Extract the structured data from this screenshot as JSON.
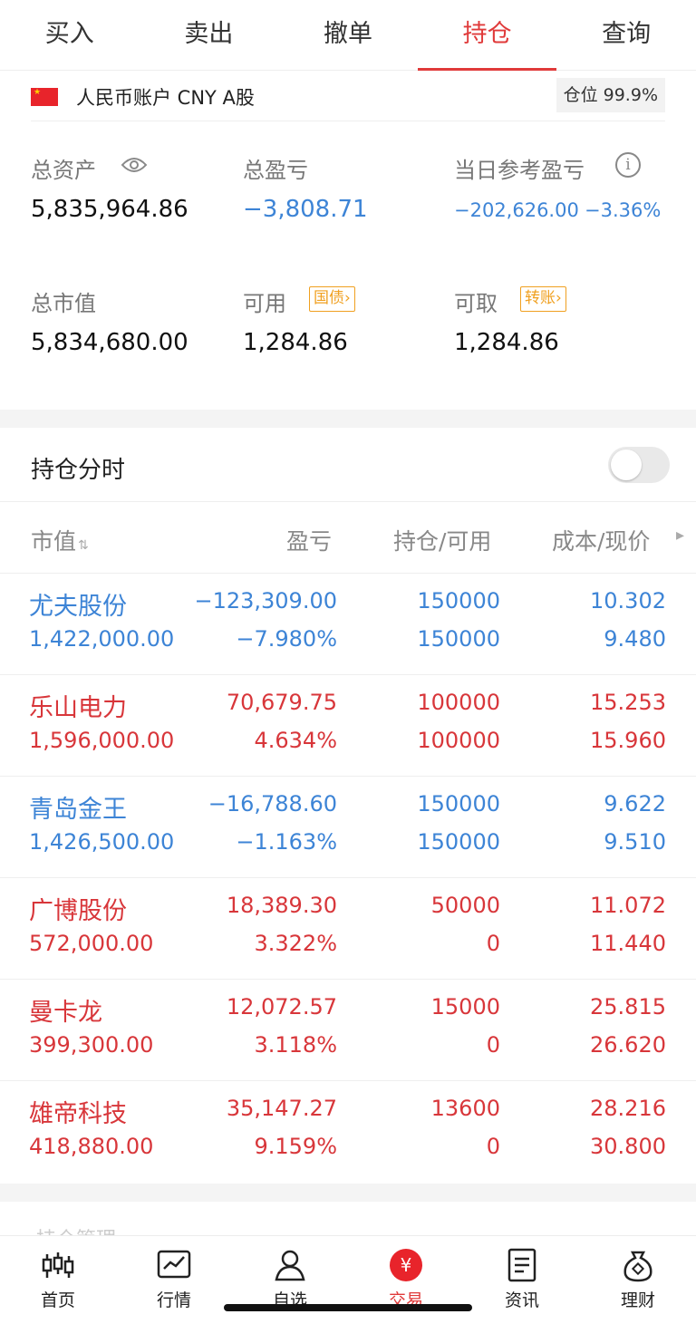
{
  "tabs": [
    "买入",
    "卖出",
    "撤单",
    "持仓",
    "查询"
  ],
  "account": {
    "name": "人民币账户 CNY A股",
    "position_ratio": "仓位 99.9%"
  },
  "summary": {
    "total_assets_label": "总资产",
    "total_assets": "5,835,964.86",
    "total_pl_label": "总盈亏",
    "total_pl": "−3,808.71",
    "daily_pl_label": "当日参考盈亏",
    "daily_pl": "−202,626.00",
    "daily_pl_pct": "−3.36%",
    "market_value_label": "总市值",
    "market_value": "5,834,680.00",
    "available_label": "可用",
    "available": "1,284.86",
    "bond_chip": "国债",
    "withdrawable_label": "可取",
    "withdrawable": "1,284.86",
    "transfer_chip": "转账"
  },
  "realtime_label": "持仓分时",
  "columns": [
    "市值",
    "盈亏",
    "持仓/可用",
    "成本/现价"
  ],
  "holdings": [
    {
      "name": "尤夫股份",
      "mv": "1,422,000.00",
      "pl": "−123,309.00",
      "pl_pct": "−7.980%",
      "qty": "150000",
      "avail": "150000",
      "cost": "10.302",
      "price": "9.480",
      "color": "#3d84d6"
    },
    {
      "name": "乐山电力",
      "mv": "1,596,000.00",
      "pl": "70,679.75",
      "pl_pct": "4.634%",
      "qty": "100000",
      "avail": "100000",
      "cost": "15.253",
      "price": "15.960",
      "color": "#d8363a"
    },
    {
      "name": "青岛金王",
      "mv": "1,426,500.00",
      "pl": "−16,788.60",
      "pl_pct": "−1.163%",
      "qty": "150000",
      "avail": "150000",
      "cost": "9.622",
      "price": "9.510",
      "color": "#3d84d6"
    },
    {
      "name": "广博股份",
      "mv": "572,000.00",
      "pl": "18,389.30",
      "pl_pct": "3.322%",
      "qty": "50000",
      "avail": "0",
      "cost": "11.072",
      "price": "11.440",
      "color": "#d8363a"
    },
    {
      "name": "曼卡龙",
      "mv": "399,300.00",
      "pl": "12,072.57",
      "pl_pct": "3.118%",
      "qty": "15000",
      "avail": "0",
      "cost": "25.815",
      "price": "26.620",
      "color": "#d8363a"
    },
    {
      "name": "雄帝科技",
      "mv": "418,880.00",
      "pl": "35,147.27",
      "pl_pct": "9.159%",
      "qty": "13600",
      "avail": "0",
      "cost": "28.216",
      "price": "30.800",
      "color": "#d8363a"
    }
  ],
  "nav": [
    "首页",
    "行情",
    "自选",
    "交易",
    "资讯",
    "理财"
  ],
  "colors": {
    "accent": "#e03a3a",
    "loss": "#3d84d6",
    "gain": "#d8363a",
    "chip": "#f0a020"
  }
}
